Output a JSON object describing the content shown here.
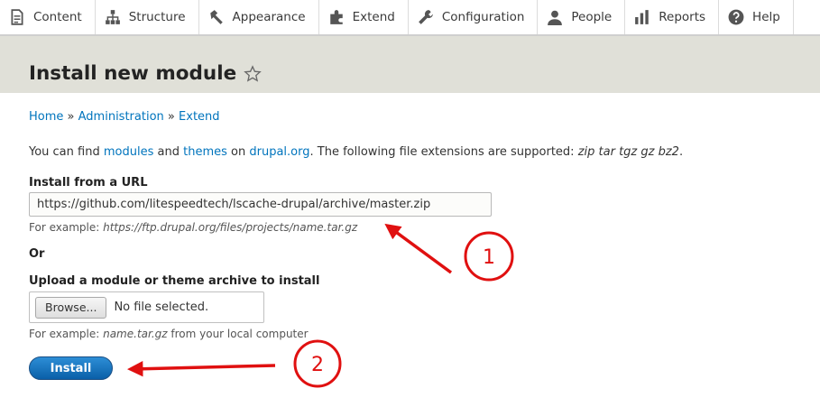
{
  "toolbar": {
    "items": [
      {
        "label": "Content",
        "icon": "content-icon"
      },
      {
        "label": "Structure",
        "icon": "structure-icon"
      },
      {
        "label": "Appearance",
        "icon": "appearance-icon"
      },
      {
        "label": "Extend",
        "icon": "extend-icon"
      },
      {
        "label": "Configuration",
        "icon": "wrench-icon"
      },
      {
        "label": "People",
        "icon": "people-icon"
      },
      {
        "label": "Reports",
        "icon": "reports-icon"
      },
      {
        "label": "Help",
        "icon": "help-icon"
      }
    ]
  },
  "page": {
    "title": "Install new module"
  },
  "breadcrumb": {
    "items": [
      "Home",
      "Administration",
      "Extend"
    ],
    "separator": "»"
  },
  "intro": {
    "text_1": "You can find",
    "link_modules": "modules",
    "text_2": "and",
    "link_themes": "themes",
    "text_3": "on",
    "link_drupal": "drupal.org",
    "text_4": ". The following file extensions are supported:",
    "extensions": "zip tar tgz gz bz2",
    "text_5": "."
  },
  "url_field": {
    "label": "Install from a URL",
    "value": "https://github.com/litespeedtech/lscache-drupal/archive/master.zip",
    "desc_prefix": "For example:",
    "desc_example": "https://ftp.drupal.org/files/projects/name.tar.gz"
  },
  "or_label": "Or",
  "upload_field": {
    "label": "Upload a module or theme archive to install",
    "browse_label": "Browse...",
    "status": "No file selected.",
    "desc_prefix": "For example:",
    "desc_example": "name.tar.gz",
    "desc_suffix": "from your local computer"
  },
  "install_button": "Install",
  "annotations": {
    "marker_1": "1",
    "marker_2": "2",
    "color": "#e01010"
  },
  "colors": {
    "link": "#0074bd",
    "header_bg": "#e0e0d8",
    "button": "#0a5fa8"
  }
}
